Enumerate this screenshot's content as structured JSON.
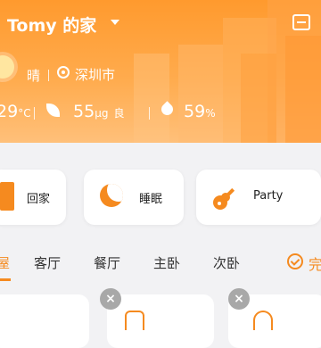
{
  "header": {
    "title": "Tomy 的家",
    "weather": "晴",
    "city": "深圳市",
    "temperature": "29",
    "temperature_unit": "°C",
    "pm25": "55",
    "pm25_unit": "μg",
    "air_quality": "良",
    "humidity": "59",
    "humidity_unit": "%"
  },
  "scenes": [
    {
      "label": "回家",
      "icon": "home-icon"
    },
    {
      "label": "睡眠",
      "icon": "moon-icon"
    },
    {
      "label": "Party",
      "icon": "guitar-icon"
    }
  ],
  "rooms": {
    "tabs": [
      "全屋",
      "客厅",
      "餐厅",
      "主卧",
      "次卧"
    ],
    "first_tab_visible": "屋",
    "complete_label": "完"
  },
  "colors": {
    "accent": "#f58a1f",
    "header_gradient_top": "#ff9a2e",
    "header_gradient_bottom": "#ffc07a",
    "background": "#f2f2f4"
  }
}
